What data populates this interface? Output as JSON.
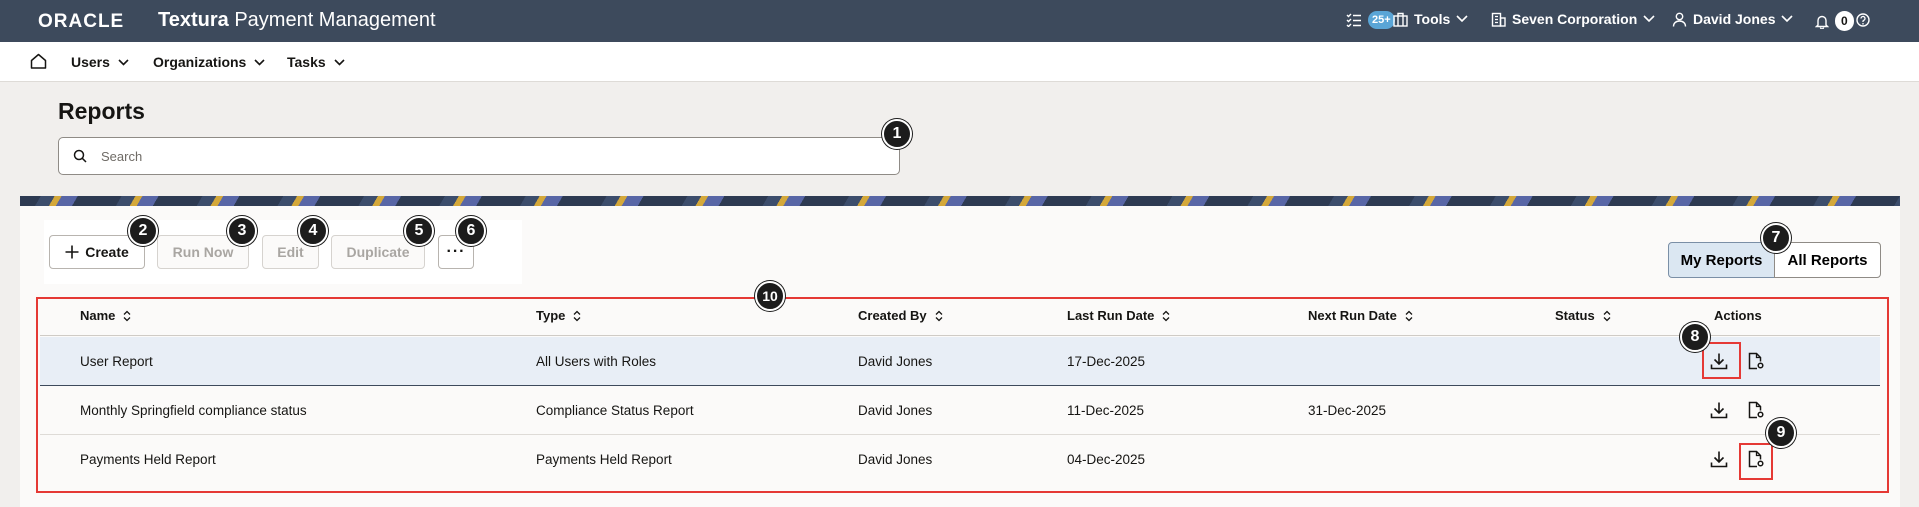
{
  "header": {
    "brand": "ORACLE",
    "app_title_bold": "Textura",
    "app_title_rest": " Payment Management",
    "tasks_badge": "25+",
    "tools_label": "Tools",
    "org_label": "Seven Corporation",
    "user_label": "David Jones",
    "notifications_count": "0"
  },
  "nav": {
    "items": [
      {
        "label": "Users"
      },
      {
        "label": "Organizations"
      },
      {
        "label": "Tasks"
      }
    ]
  },
  "page": {
    "title": "Reports",
    "search_placeholder": "Search"
  },
  "toolbar": {
    "create_label": "Create",
    "run_now_label": "Run Now",
    "edit_label": "Edit",
    "duplicate_label": "Duplicate",
    "more_label": "···"
  },
  "view_toggle": {
    "my_reports": "My Reports",
    "all_reports": "All Reports",
    "selected": "My Reports"
  },
  "table": {
    "columns": [
      "Name",
      "Type",
      "Created By",
      "Last Run Date",
      "Next Run Date",
      "Status",
      "Actions"
    ],
    "rows": [
      {
        "name": "User Report",
        "type": "All Users with Roles",
        "created_by": "David Jones",
        "last_run": "17-Dec-2025",
        "next_run": "",
        "status": "",
        "selected": true
      },
      {
        "name": "Monthly Springfield compliance status",
        "type": "Compliance Status Report",
        "created_by": "David Jones",
        "last_run": "11-Dec-2025",
        "next_run": "31-Dec-2025",
        "status": ""
      },
      {
        "name": "Payments Held Report",
        "type": "Payments Held Report",
        "created_by": "David Jones",
        "last_run": "04-Dec-2025",
        "next_run": "",
        "status": ""
      }
    ]
  },
  "annotations": [
    "1",
    "2",
    "3",
    "4",
    "5",
    "6",
    "7",
    "8",
    "9",
    "10"
  ],
  "colors": {
    "header_bg": "#3d4a5c",
    "selected_row": "#e8eef6",
    "toggle_selected": "#dbe7f2",
    "annotation_red": "#e53935"
  }
}
